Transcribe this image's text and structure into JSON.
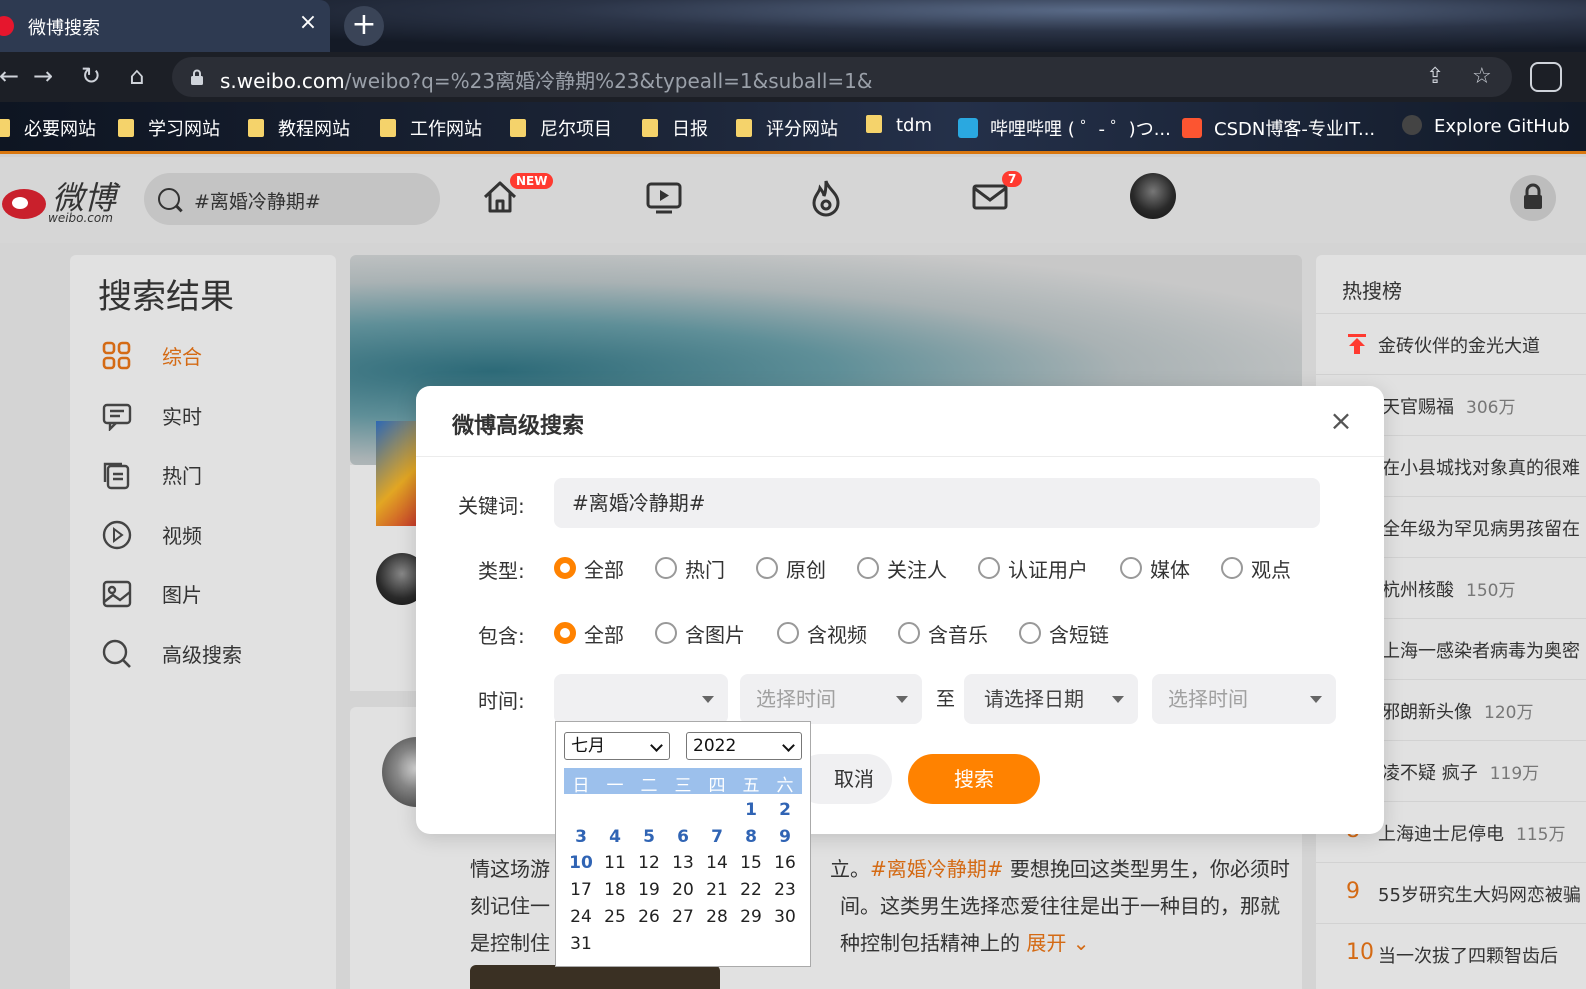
{
  "browser": {
    "tab_title": "微博搜索",
    "tab_close": "×",
    "new_tab": "+",
    "url_host": "s.weibo.com",
    "url_path": "/weibo?q=%23离婚冷静期%23&typeall=1&suball=1&",
    "bookmarks": [
      "必要网站",
      "学习网站",
      "教程网站",
      "工作网站",
      "尼尔项目",
      "日报",
      "评分网站",
      "tdm",
      "哔哩哔哩 ( ゜- ゜)つ...",
      "CSDN博客-专业IT...",
      "Explore GitHub"
    ]
  },
  "header": {
    "logo_text": "微博",
    "logo_sub": "weibo.com",
    "search_value": "#离婚冷静期#",
    "home_badge": "NEW",
    "mail_badge": "7"
  },
  "left_nav": {
    "title": "搜索结果",
    "items": [
      "综合",
      "实时",
      "热门",
      "视频",
      "图片",
      "高级搜索"
    ]
  },
  "post": {
    "line1_a": "情这场游",
    "line1_b": "立。",
    "line1_tag": "#离婚冷静期#",
    "line1_c": " 要想挽回这类型男生，你必须时",
    "line2_a": "刻记住一",
    "line2_b": "间。这类男生选择恋爱往往是出于一种目的，那就",
    "line3_a": "是控制住",
    "line3_b": "种控制包括精神上的 ",
    "expand": "展开"
  },
  "hot_list": {
    "title": "热搜榜",
    "items": [
      {
        "rank": "",
        "text": "金砖伙伴的金光大道",
        "count": ""
      },
      {
        "rank": "",
        "text": "天官赐福",
        "count": "306万"
      },
      {
        "rank": "",
        "text": "在小县城找对象真的很难",
        "count": ""
      },
      {
        "rank": "",
        "text": "全年级为罕见病男孩留在",
        "count": ""
      },
      {
        "rank": "",
        "text": "杭州核酸",
        "count": "150万"
      },
      {
        "rank": "",
        "text": "上海一感染者病毒为奥密",
        "count": ""
      },
      {
        "rank": "",
        "text": "邪朗新头像",
        "count": "120万"
      },
      {
        "rank": "",
        "text": "凌不疑 疯子",
        "count": "119万"
      },
      {
        "rank": "8",
        "text": "上海迪士尼停电",
        "count": "115万"
      },
      {
        "rank": "9",
        "text": "55岁研究生大妈网恋被骗",
        "count": ""
      },
      {
        "rank": "10",
        "text": "当一次拔了四颗智齿后",
        "count": ""
      }
    ]
  },
  "modal": {
    "title": "微博高级搜索",
    "close": "×",
    "keyword_label": "关键词:",
    "keyword_value": "#离婚冷静期#",
    "type_label": "类型:",
    "type_options": [
      "全部",
      "热门",
      "原创",
      "关注人",
      "认证用户",
      "媒体",
      "观点"
    ],
    "include_label": "包含:",
    "include_options": [
      "全部",
      "含图片",
      "含视频",
      "含音乐",
      "含短链"
    ],
    "time_label": "时间:",
    "start_date_value": "",
    "start_time_placeholder": "选择时间",
    "to_label": "至",
    "end_date_placeholder": "请选择日期",
    "end_time_placeholder": "选择时间",
    "cancel": "取消",
    "search": "搜索"
  },
  "datepicker": {
    "month": "七月",
    "year": "2022",
    "weekdays": [
      "日",
      "一",
      "二",
      "三",
      "四",
      "五",
      "六"
    ],
    "today": "10"
  },
  "colors": {
    "accent": "#ff8200",
    "weibo_orange": "#d46a14",
    "badge_red": "#ff3a30"
  }
}
